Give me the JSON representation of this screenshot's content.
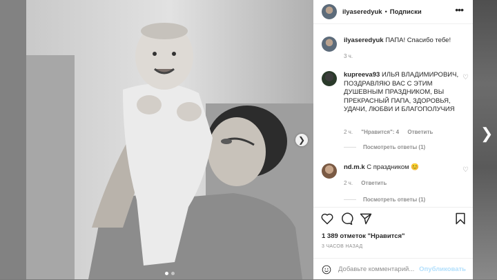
{
  "header": {
    "username": "ilyaseredyuk",
    "separator": "•",
    "follow_label": "Подписки",
    "more": "•••"
  },
  "caption": {
    "username": "ilyaseredyuk",
    "text": "ПАПА! Спасибо тебе!",
    "time": "3 ч."
  },
  "comments": [
    {
      "username": "kupreeva93",
      "text": "ИЛЬЯ ВЛАДИМИРОВИЧ, ПОЗДРАВЛЯЮ ВАС С ЭТИМ ДУШЕВНЫМ ПРАЗДНИКОМ, ВЫ ПРЕКРАСНЫЙ ПАПА, ЗДОРОВЬЯ, УДАЧИ, ЛЮБВИ И БЛАГОПОЛУЧИЯ",
      "time": "2 ч.",
      "likes": "\"Нравится\": 4",
      "reply": "Ответить",
      "view_replies": "Посмотреть ответы (1)"
    },
    {
      "username": "nd.m.k",
      "text": "С праздником 😊",
      "time": "2 ч.",
      "reply": "Ответить",
      "view_replies": "Посмотреть ответы (1)"
    }
  ],
  "stats": {
    "likes": "1 389 отметок \"Нравится\"",
    "posted": "3 ЧАСОВ НАЗАД"
  },
  "add_comment": {
    "placeholder": "Добавьте комментарий...",
    "publish_label": "Опубликовать"
  },
  "colors": {
    "link_disabled": "#b2dffc",
    "text": "#262626",
    "muted": "#8e8e8e"
  }
}
